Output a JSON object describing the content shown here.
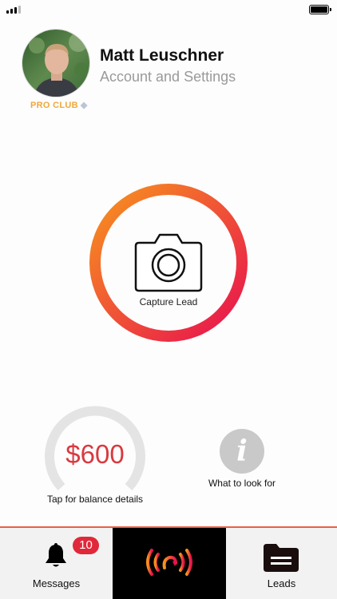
{
  "profile": {
    "name": "Matt Leuschner",
    "subtitle": "Account and Settings",
    "membership": "PRO CLUB"
  },
  "capture": {
    "label": "Capture Lead",
    "ring_colors": [
      "#f7931e",
      "#e8114f"
    ]
  },
  "balance": {
    "amount": "$600",
    "label": "Tap for balance details",
    "color": "#d9393f"
  },
  "info": {
    "glyph": "i",
    "label": "What to look for"
  },
  "tabs": {
    "messages": {
      "label": "Messages",
      "badge": "10",
      "icon": "bell-icon"
    },
    "capture": {
      "icon": "capture-signal-icon"
    },
    "leads": {
      "label": "Leads",
      "icon": "folder-icon"
    }
  },
  "colors": {
    "accent": "#e8604a",
    "badge": "#e0283a",
    "pro": "#f0a83a"
  }
}
